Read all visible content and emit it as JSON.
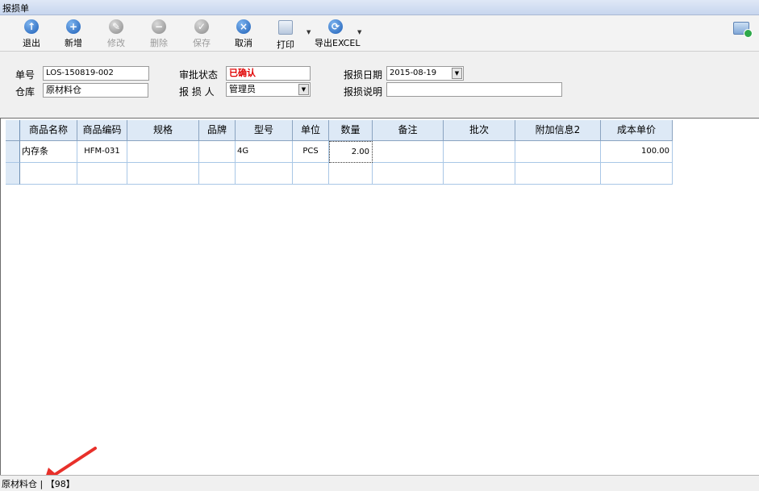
{
  "window": {
    "title": "报损单"
  },
  "toolbar": {
    "buttons": [
      {
        "label": "退出",
        "icon": "exit-icon",
        "enabled": true
      },
      {
        "label": "新增",
        "icon": "add-icon",
        "enabled": true
      },
      {
        "label": "修改",
        "icon": "edit-icon",
        "enabled": false
      },
      {
        "label": "删除",
        "icon": "delete-icon",
        "enabled": false
      },
      {
        "label": "保存",
        "icon": "save-icon",
        "enabled": false
      },
      {
        "label": "取消",
        "icon": "cancel-icon",
        "enabled": true
      },
      {
        "label": "打印",
        "icon": "print-icon",
        "enabled": true
      },
      {
        "label": "导出EXCEL",
        "icon": "export-icon",
        "enabled": true
      }
    ]
  },
  "form": {
    "order_no_label": "单号",
    "order_no": "LOS-150819-002",
    "warehouse_label": "仓库",
    "warehouse": "原材料仓",
    "approval_label": "审批状态",
    "approval_status": "已确认",
    "reporter_label": "报 损 人",
    "reporter": "管理员",
    "date_label": "报损日期",
    "date": "2015-08-19",
    "note_label": "报损说明",
    "note": ""
  },
  "grid": {
    "columns": [
      "商品名称",
      "商品编码",
      "规格",
      "品牌",
      "型号",
      "单位",
      "数量",
      "备注",
      "批次",
      "附加信息2",
      "成本单价"
    ],
    "rows": [
      [
        "内存条",
        "HFM-031",
        "",
        "",
        "4G",
        "PCS",
        "2.00",
        "",
        "",
        "",
        "100.00"
      ],
      [
        "",
        "",
        "",
        "",
        "",
        "",
        "",
        "",
        "",
        "",
        ""
      ]
    ]
  },
  "statusbar": {
    "text": "原材料仓 | 【98】"
  },
  "colors": {
    "accent": "#1e5fb7",
    "status_red": "#e00000",
    "grid_line": "#a9c7e6",
    "header_bg": "#dde9f6"
  }
}
